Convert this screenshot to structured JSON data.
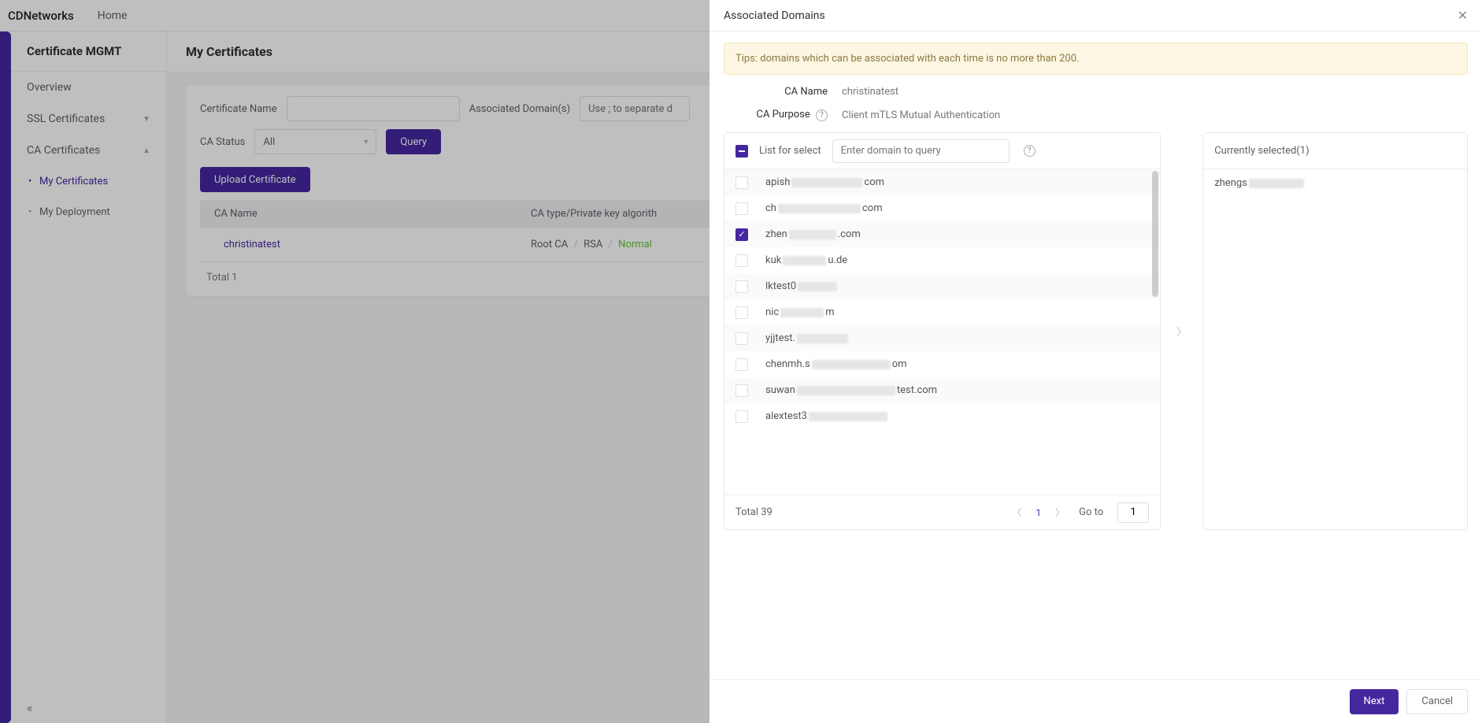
{
  "topbar": {
    "brand": "CDNetworks",
    "home": "Home"
  },
  "sidebar": {
    "title": "Certificate MGMT",
    "overview": "Overview",
    "ssl": "SSL Certificates",
    "ca": "CA Certificates",
    "mycerts": "My Certificates",
    "mydeploy": "My Deployment"
  },
  "page": {
    "title": "My Certificates"
  },
  "filters": {
    "cert_name_label": "Certificate Name",
    "assoc_label": "Associated Domain(s)",
    "assoc_placeholder": "Use ; to separate d",
    "ca_status_label": "CA Status",
    "ca_status_value": "All",
    "query_btn": "Query",
    "upload_btn": "Upload Certificate"
  },
  "table": {
    "col_name": "CA Name",
    "col_type": "CA type/Private key algorith",
    "row_name": "christinatest",
    "row_type_a": "Root CA",
    "row_type_b": "RSA",
    "row_status": "Normal",
    "sep": "/",
    "total": "Total 1"
  },
  "drawer": {
    "title": "Associated Domains",
    "tip": "Tips: domains which can be associated with each time is no more than 200.",
    "ca_name_label": "CA Name",
    "ca_name_value": "christinatest",
    "ca_purpose_label": "CA Purpose",
    "ca_purpose_value": "Client mTLS Mutual Authentication",
    "list_label": "List for select",
    "list_placeholder": "Enter domain to query",
    "selected_label_prefix": "Currently selected(",
    "selected_count": "1",
    "selected_label_suffix": ")",
    "domains": [
      {
        "prefix": "apish",
        "blur_w": 90,
        "suffix": "com",
        "checked": false
      },
      {
        "prefix": "ch",
        "blur_w": 105,
        "suffix": "com",
        "checked": false
      },
      {
        "prefix": "zhen",
        "blur_w": 60,
        "suffix": ".com",
        "checked": true
      },
      {
        "prefix": "kuk",
        "blur_w": 55,
        "suffix": "u.de",
        "checked": false
      },
      {
        "prefix": "lktest0",
        "blur_w": 50,
        "suffix": "",
        "checked": false
      },
      {
        "prefix": "nic",
        "blur_w": 55,
        "suffix": "m",
        "checked": false
      },
      {
        "prefix": "yjjtest.",
        "blur_w": 65,
        "suffix": "",
        "checked": false
      },
      {
        "prefix": "chenmh.s",
        "blur_w": 100,
        "suffix": "om",
        "checked": false
      },
      {
        "prefix": "suwan",
        "blur_w": 125,
        "suffix": "test.com",
        "checked": false
      },
      {
        "prefix": "alextest3",
        "blur_w": 100,
        "suffix": "",
        "checked": false
      }
    ],
    "selected_domain": {
      "prefix": "zhengs",
      "blur_w": 70,
      "suffix": ""
    },
    "foot_total": "Total 39",
    "page_cur": "1",
    "goto_label": "Go to",
    "goto_val": "1",
    "next_btn": "Next",
    "cancel_btn": "Cancel"
  }
}
